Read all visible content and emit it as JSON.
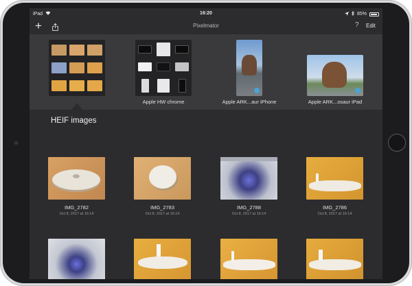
{
  "status": {
    "device": "iPad",
    "time": "16:20",
    "battery": "85%"
  },
  "nav": {
    "title": "Pixelmator",
    "add_icon": "plus-icon",
    "share_icon": "share-icon",
    "help_icon": "question-icon",
    "edit_label": "Edit"
  },
  "albums": [
    {
      "label": ""
    },
    {
      "label": "Apple HW chrome"
    },
    {
      "label": "Apple ARK...aur iPhone"
    },
    {
      "label": "Apple ARK...osaur iPad"
    }
  ],
  "section": {
    "title": "HEIF images"
  },
  "photos": [
    {
      "name": "IMG_2782",
      "date": "Oct 8, 2017 at 16:14"
    },
    {
      "name": "IMG_2783",
      "date": "Oct 8, 2017 at 16:14"
    },
    {
      "name": "IMG_2788",
      "date": "Oct 8, 2017 at 16:14"
    },
    {
      "name": "IMG_2786",
      "date": "Oct 8, 2017 at 16:14"
    }
  ],
  "colors": {
    "screen_bg": "#2c2c2e",
    "strip_bg": "#3a3a3c",
    "text": "#e2e2e4"
  }
}
